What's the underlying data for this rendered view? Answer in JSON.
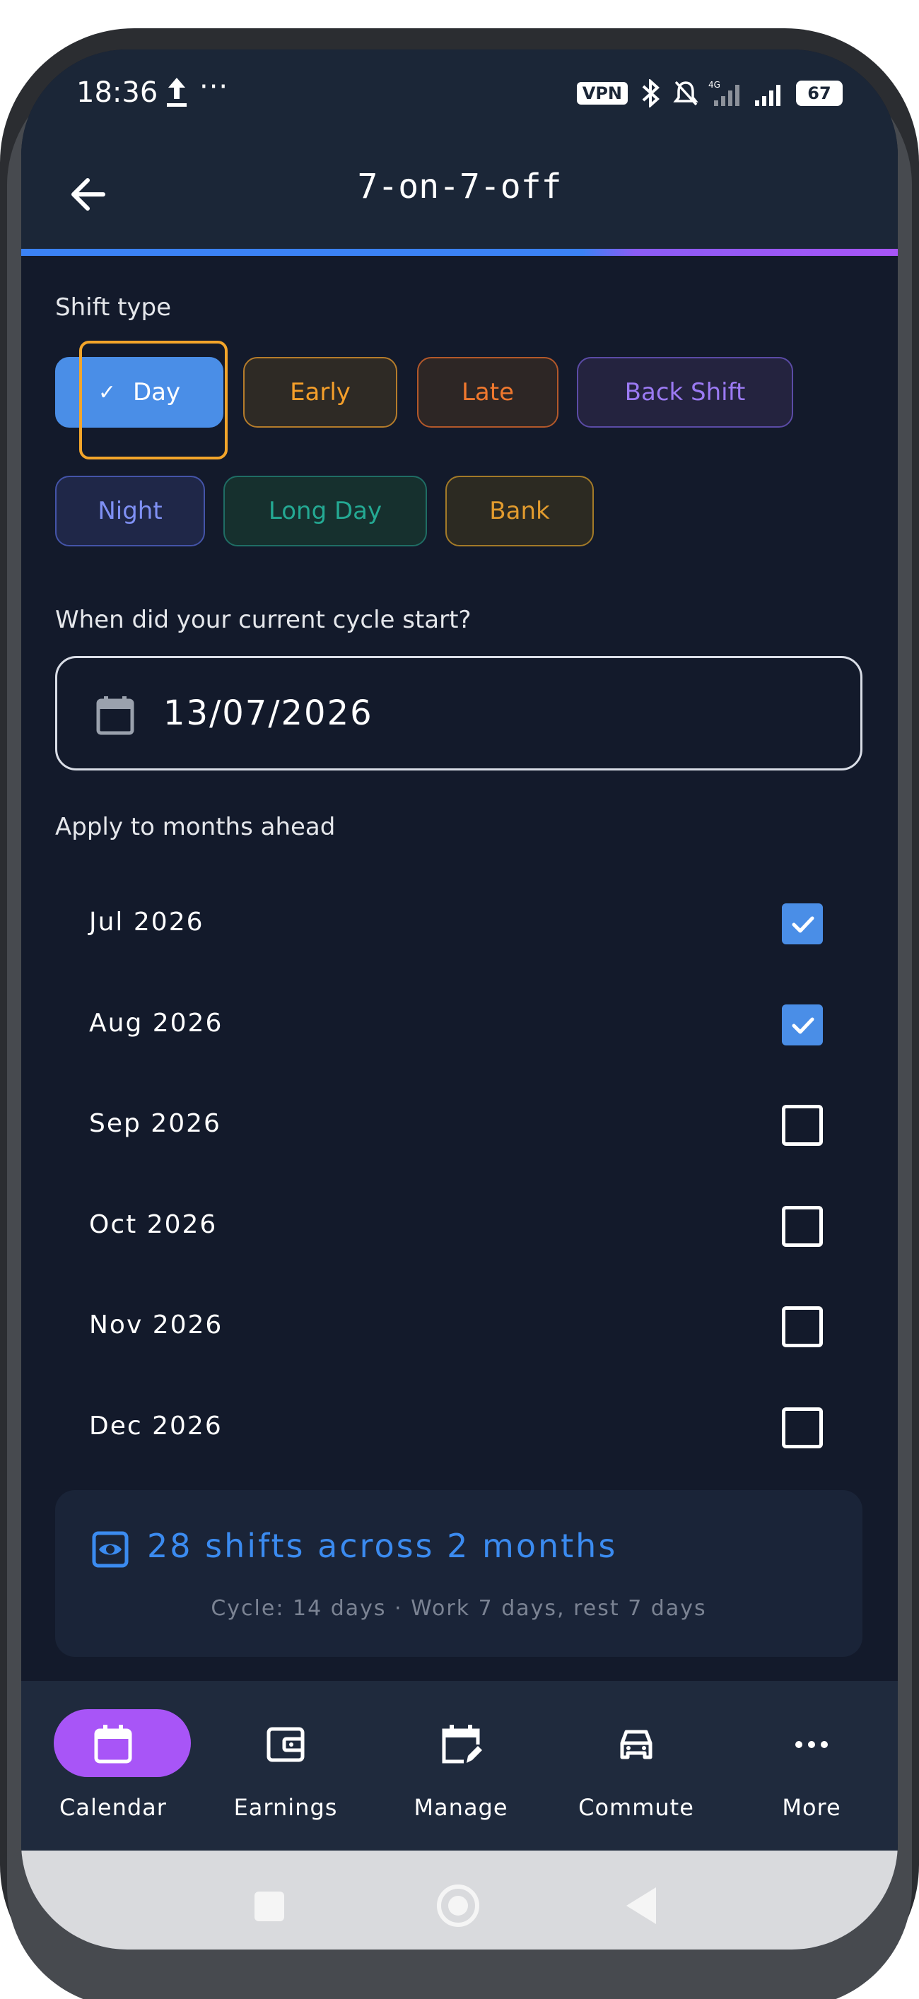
{
  "status_bar": {
    "time": "18:36",
    "overflow": "···",
    "vpn": "VPN",
    "network": "4G",
    "battery": "67"
  },
  "app_bar": {
    "title": "7-on-7-off"
  },
  "shift_type": {
    "label": "Shift type",
    "chips": [
      {
        "label": "Day",
        "selected": true,
        "color": "#4a8ee7"
      },
      {
        "label": "Early",
        "selected": false,
        "color": "#f59f2a"
      },
      {
        "label": "Late",
        "selected": false,
        "color": "#f0782e"
      },
      {
        "label": "Back Shift",
        "selected": false,
        "color": "#9b7af3"
      },
      {
        "label": "Night",
        "selected": false,
        "color": "#7f90f4"
      },
      {
        "label": "Long Day",
        "selected": false,
        "color": "#24a993"
      },
      {
        "label": "Bank",
        "selected": false,
        "color": "#e29b2e"
      }
    ]
  },
  "cycle_start": {
    "label": "When did your current cycle start?",
    "value": "13/07/2026"
  },
  "months": {
    "label": "Apply to months ahead",
    "items": [
      {
        "label": "Jul 2026",
        "checked": true
      },
      {
        "label": "Aug 2026",
        "checked": true
      },
      {
        "label": "Sep 2026",
        "checked": false
      },
      {
        "label": "Oct 2026",
        "checked": false
      },
      {
        "label": "Nov 2026",
        "checked": false
      },
      {
        "label": "Dec 2026",
        "checked": false
      }
    ]
  },
  "summary": {
    "title": "28 shifts across 2 months",
    "subtitle": "Cycle: 14 days · Work 7 days, rest 7 days"
  },
  "bottom_nav": {
    "items": [
      {
        "label": "Calendar",
        "active": true,
        "icon": "calendar-icon"
      },
      {
        "label": "Earnings",
        "active": false,
        "icon": "wallet-icon"
      },
      {
        "label": "Manage",
        "active": false,
        "icon": "calendar-edit-icon"
      },
      {
        "label": "Commute",
        "active": false,
        "icon": "car-icon"
      },
      {
        "label": "More",
        "active": false,
        "icon": "more-icon"
      }
    ]
  },
  "colors": {
    "accent": "#4a8ee7",
    "active_nav": "#a855f7",
    "focus": "#f3a52a",
    "background": "#131a2b"
  }
}
